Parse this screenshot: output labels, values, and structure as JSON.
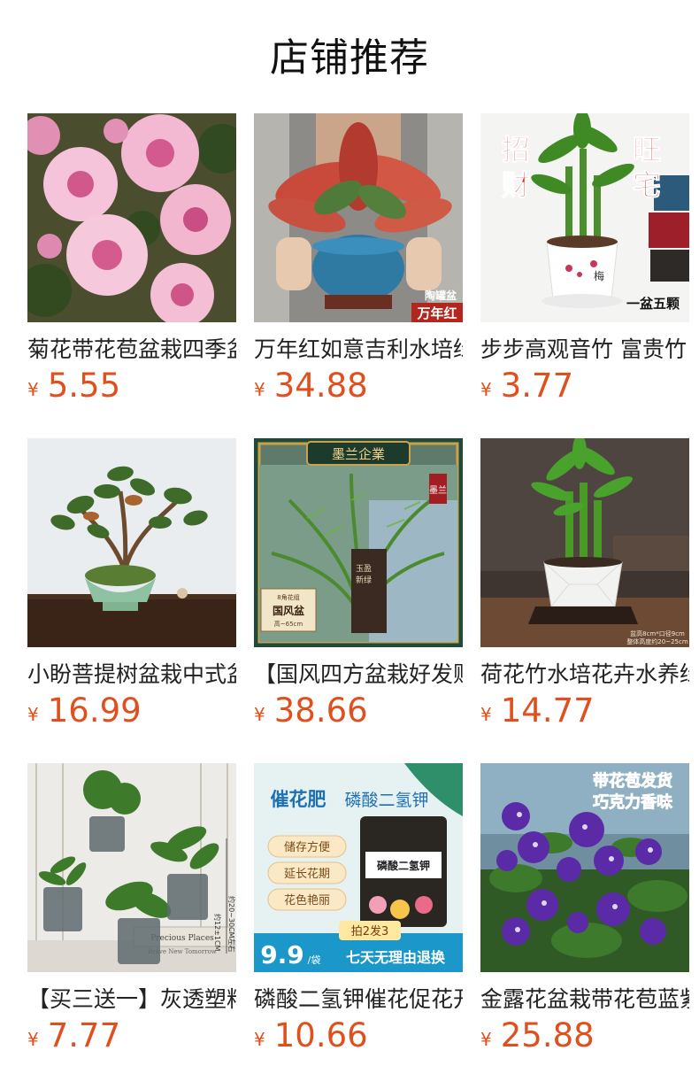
{
  "header": {
    "title": "店铺推荐"
  },
  "products": [
    {
      "name": "菊花带花苞盆栽四季盆栽",
      "currency": "¥",
      "price": "5.55",
      "image_text": [],
      "icon": "chrysanthemum-image"
    },
    {
      "name": "万年红如意吉利水培绿植",
      "currency": "¥",
      "price": "34.88",
      "image_text": [
        "陶罐盆",
        "万年红"
      ],
      "icon": "aglaonema-image"
    },
    {
      "name": "步步高观音竹 富贵竹",
      "currency": "¥",
      "price": "3.77",
      "image_text": [
        "招",
        "财",
        "旺",
        "宅",
        "梅",
        "一盆五颗"
      ],
      "icon": "lucky-bamboo-image"
    },
    {
      "name": "小盼菩提树盆栽中式盆景",
      "currency": "¥",
      "price": "16.99",
      "image_text": [],
      "icon": "bodhi-bonsai-image"
    },
    {
      "name": "【国风四方盆栽好发财树",
      "currency": "¥",
      "price": "38.66",
      "image_text": [
        "墨兰企業",
        "墨兰",
        "8角花组",
        "国风盆",
        "高~65cm",
        "玉盈",
        "新绿"
      ],
      "icon": "areca-palm-image"
    },
    {
      "name": "荷花竹水培花卉水养绿植",
      "currency": "¥",
      "price": "14.77",
      "image_text": [
        "盆高8cm*口径9cm",
        "整体高度约20~25cm"
      ],
      "icon": "lotus-bamboo-image"
    },
    {
      "name": "【买三送一】灰透塑料盆",
      "currency": "¥",
      "price": "7.77",
      "image_text": [
        "约20~30CM左右",
        "约12±1CM",
        "Precious Places",
        "Brave New Tomorrow"
      ],
      "icon": "grey-pots-image"
    },
    {
      "name": "磷酸二氢钾催花促花开",
      "currency": "¥",
      "price": "10.66",
      "image_text": [
        "催花肥",
        "磷酸二氢钾",
        "储存方便",
        "延长花期",
        "花色艳丽",
        "磷酸二氢钾",
        "拍2发3",
        "9.9",
        "/袋",
        "七天无理由退换"
      ],
      "icon": "fertilizer-bag-image"
    },
    {
      "name": "金露花盆栽带花苞蓝紫色",
      "currency": "¥",
      "price": "25.88",
      "image_text": [
        "带花苞发货",
        "巧克力香味"
      ],
      "icon": "duranta-flower-image"
    }
  ],
  "colors": {
    "price": "#e0501f",
    "title": "#111111",
    "name": "#222222",
    "background": "#ffffff"
  }
}
